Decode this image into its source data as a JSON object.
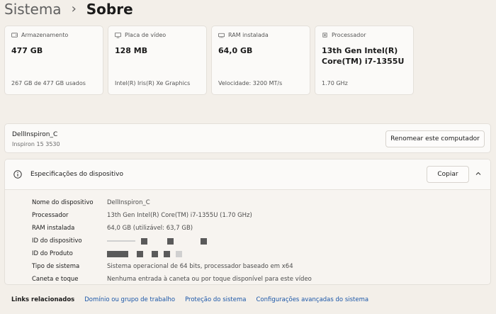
{
  "breadcrumb": {
    "parent": "Sistema",
    "separator": "›",
    "current": "Sobre"
  },
  "cards": [
    {
      "icon": "storage-icon",
      "label": "Armazenamento",
      "value": "477 GB",
      "sub": "267 GB de 477 GB usados"
    },
    {
      "icon": "gpu-icon",
      "label": "Placa de vídeo",
      "value": "128 MB",
      "sub": "Intel(R) Iris(R) Xe Graphics"
    },
    {
      "icon": "ram-icon",
      "label": "RAM instalada",
      "value": "64,0 GB",
      "sub": "Velocidade: 3200 MT/s"
    },
    {
      "icon": "cpu-icon",
      "label": "Processador",
      "value": "13th Gen Intel(R) Core(TM) i7-1355U",
      "sub": "1.70 GHz"
    }
  ],
  "device": {
    "name": "DellInspiron_C",
    "model": "Inspiron 15 3530",
    "rename_label": "Renomear este computador"
  },
  "specs": {
    "title": "Especificações do dispositivo",
    "copy_label": "Copiar",
    "rows": [
      {
        "key": "Nome do dispositivo",
        "value": "DellInspiron_C"
      },
      {
        "key": "Processador",
        "value": "13th Gen Intel(R) Core(TM) i7-1355U (1.70 GHz)"
      },
      {
        "key": "RAM instalada",
        "value": "64,0 GB (utilizável: 63,7 GB)"
      },
      {
        "key": "ID do dispositivo",
        "value": ""
      },
      {
        "key": "ID do Produto",
        "value": ""
      },
      {
        "key": "Tipo de sistema",
        "value": "Sistema operacional de 64 bits, processador baseado em x64"
      },
      {
        "key": "Caneta e toque",
        "value": "Nenhuma entrada à caneta ou por toque disponível para este vídeo"
      }
    ]
  },
  "links": {
    "label": "Links relacionados",
    "items": [
      "Domínio ou grupo de trabalho",
      "Proteção do sistema",
      "Configurações avançadas do sistema"
    ]
  }
}
